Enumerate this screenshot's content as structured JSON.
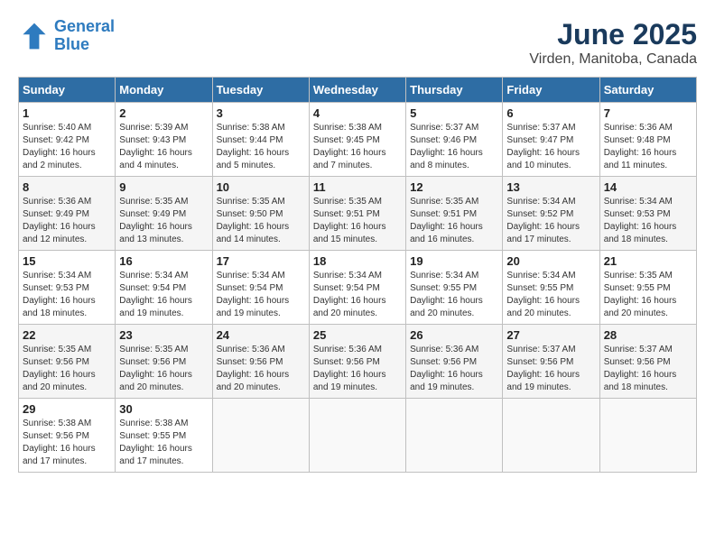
{
  "logo": {
    "line1": "General",
    "line2": "Blue"
  },
  "title": "June 2025",
  "subtitle": "Virden, Manitoba, Canada",
  "days_of_week": [
    "Sunday",
    "Monday",
    "Tuesday",
    "Wednesday",
    "Thursday",
    "Friday",
    "Saturday"
  ],
  "weeks": [
    [
      {
        "day": 1,
        "sunrise": "5:40 AM",
        "sunset": "9:42 PM",
        "daylight": "16 hours and 2 minutes."
      },
      {
        "day": 2,
        "sunrise": "5:39 AM",
        "sunset": "9:43 PM",
        "daylight": "16 hours and 4 minutes."
      },
      {
        "day": 3,
        "sunrise": "5:38 AM",
        "sunset": "9:44 PM",
        "daylight": "16 hours and 5 minutes."
      },
      {
        "day": 4,
        "sunrise": "5:38 AM",
        "sunset": "9:45 PM",
        "daylight": "16 hours and 7 minutes."
      },
      {
        "day": 5,
        "sunrise": "5:37 AM",
        "sunset": "9:46 PM",
        "daylight": "16 hours and 8 minutes."
      },
      {
        "day": 6,
        "sunrise": "5:37 AM",
        "sunset": "9:47 PM",
        "daylight": "16 hours and 10 minutes."
      },
      {
        "day": 7,
        "sunrise": "5:36 AM",
        "sunset": "9:48 PM",
        "daylight": "16 hours and 11 minutes."
      }
    ],
    [
      {
        "day": 8,
        "sunrise": "5:36 AM",
        "sunset": "9:49 PM",
        "daylight": "16 hours and 12 minutes."
      },
      {
        "day": 9,
        "sunrise": "5:35 AM",
        "sunset": "9:49 PM",
        "daylight": "16 hours and 13 minutes."
      },
      {
        "day": 10,
        "sunrise": "5:35 AM",
        "sunset": "9:50 PM",
        "daylight": "16 hours and 14 minutes."
      },
      {
        "day": 11,
        "sunrise": "5:35 AM",
        "sunset": "9:51 PM",
        "daylight": "16 hours and 15 minutes."
      },
      {
        "day": 12,
        "sunrise": "5:35 AM",
        "sunset": "9:51 PM",
        "daylight": "16 hours and 16 minutes."
      },
      {
        "day": 13,
        "sunrise": "5:34 AM",
        "sunset": "9:52 PM",
        "daylight": "16 hours and 17 minutes."
      },
      {
        "day": 14,
        "sunrise": "5:34 AM",
        "sunset": "9:53 PM",
        "daylight": "16 hours and 18 minutes."
      }
    ],
    [
      {
        "day": 15,
        "sunrise": "5:34 AM",
        "sunset": "9:53 PM",
        "daylight": "16 hours and 18 minutes."
      },
      {
        "day": 16,
        "sunrise": "5:34 AM",
        "sunset": "9:54 PM",
        "daylight": "16 hours and 19 minutes."
      },
      {
        "day": 17,
        "sunrise": "5:34 AM",
        "sunset": "9:54 PM",
        "daylight": "16 hours and 19 minutes."
      },
      {
        "day": 18,
        "sunrise": "5:34 AM",
        "sunset": "9:54 PM",
        "daylight": "16 hours and 20 minutes."
      },
      {
        "day": 19,
        "sunrise": "5:34 AM",
        "sunset": "9:55 PM",
        "daylight": "16 hours and 20 minutes."
      },
      {
        "day": 20,
        "sunrise": "5:34 AM",
        "sunset": "9:55 PM",
        "daylight": "16 hours and 20 minutes."
      },
      {
        "day": 21,
        "sunrise": "5:35 AM",
        "sunset": "9:55 PM",
        "daylight": "16 hours and 20 minutes."
      }
    ],
    [
      {
        "day": 22,
        "sunrise": "5:35 AM",
        "sunset": "9:56 PM",
        "daylight": "16 hours and 20 minutes."
      },
      {
        "day": 23,
        "sunrise": "5:35 AM",
        "sunset": "9:56 PM",
        "daylight": "16 hours and 20 minutes."
      },
      {
        "day": 24,
        "sunrise": "5:36 AM",
        "sunset": "9:56 PM",
        "daylight": "16 hours and 20 minutes."
      },
      {
        "day": 25,
        "sunrise": "5:36 AM",
        "sunset": "9:56 PM",
        "daylight": "16 hours and 19 minutes."
      },
      {
        "day": 26,
        "sunrise": "5:36 AM",
        "sunset": "9:56 PM",
        "daylight": "16 hours and 19 minutes."
      },
      {
        "day": 27,
        "sunrise": "5:37 AM",
        "sunset": "9:56 PM",
        "daylight": "16 hours and 19 minutes."
      },
      {
        "day": 28,
        "sunrise": "5:37 AM",
        "sunset": "9:56 PM",
        "daylight": "16 hours and 18 minutes."
      }
    ],
    [
      {
        "day": 29,
        "sunrise": "5:38 AM",
        "sunset": "9:56 PM",
        "daylight": "16 hours and 17 minutes."
      },
      {
        "day": 30,
        "sunrise": "5:38 AM",
        "sunset": "9:55 PM",
        "daylight": "16 hours and 17 minutes."
      },
      null,
      null,
      null,
      null,
      null
    ]
  ]
}
